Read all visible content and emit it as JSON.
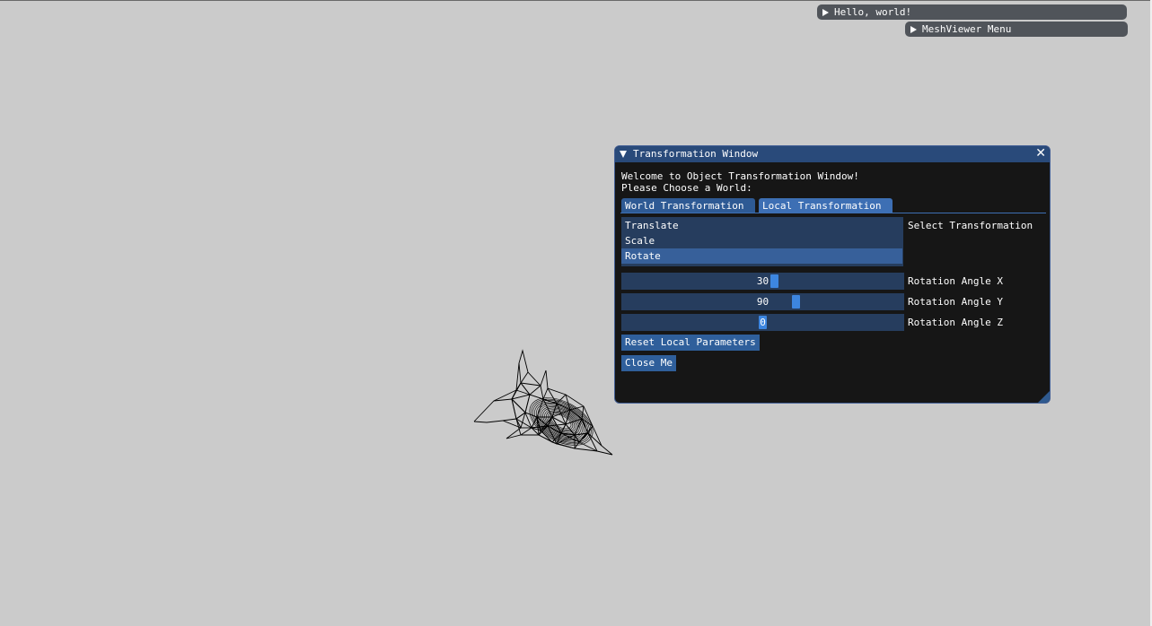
{
  "windows": {
    "hello": {
      "title": "Hello, world!"
    },
    "meshviewer": {
      "title": "MeshViewer Menu"
    }
  },
  "transform_window": {
    "title": "Transformation Window",
    "welcome_line1": "Welcome to Object Transformation Window!",
    "welcome_line2": "Please Choose a World:",
    "tabs": [
      "World Transformation",
      "Local Transformation"
    ],
    "active_tab": "Local Transformation",
    "transformations": [
      "Translate",
      "Scale",
      "Rotate"
    ],
    "selected_transformation": "Rotate",
    "select_label": "Select Transformation",
    "sliders": [
      {
        "label": "Rotation Angle X",
        "value": "30"
      },
      {
        "label": "Rotation Angle Y",
        "value": "90"
      },
      {
        "label": "Rotation Angle Z",
        "value": "0"
      }
    ],
    "reset_button": "Reset Local Parameters",
    "close_button": "Close Me"
  },
  "colors": {
    "background": "#cbcbcb",
    "window_bg": "#161616",
    "title_bar": "#294a7a",
    "accent": "#3d86e0"
  }
}
